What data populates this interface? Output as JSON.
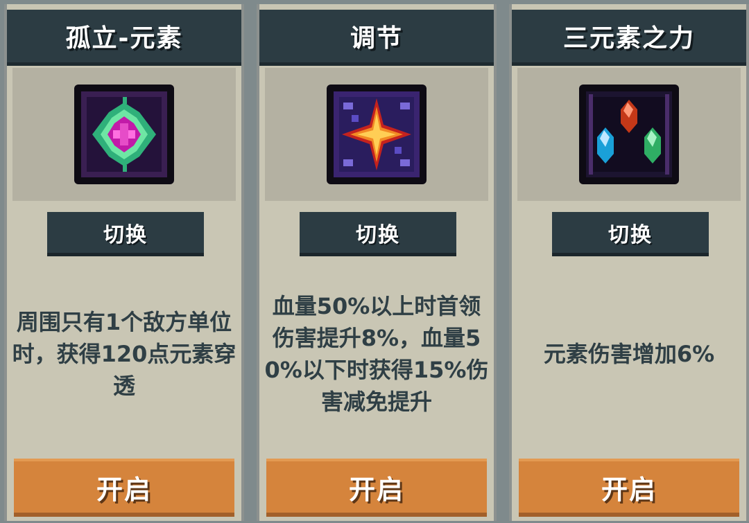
{
  "cards": [
    {
      "title": "孤立-元素",
      "icon": "green-pink-gem-icon",
      "switch_label": "切换",
      "description": "周围只有1个敌方单位时，获得120点元素穿透",
      "open_label": "开启"
    },
    {
      "title": "调节",
      "icon": "golden-star-icon",
      "switch_label": "切换",
      "description": "血量50%以上时首领伤害提升8%，血量50%以下时获得15%伤害减免提升",
      "open_label": "开启"
    },
    {
      "title": "三元素之力",
      "icon": "three-crystals-icon",
      "switch_label": "切换",
      "description": "元素伤害增加6%",
      "open_label": "开启"
    }
  ],
  "colors": {
    "card_bg": "#c9c6b4",
    "header_bg": "#2c3c43",
    "description_text": "#2f3f45",
    "open_button": "#d5843c"
  }
}
